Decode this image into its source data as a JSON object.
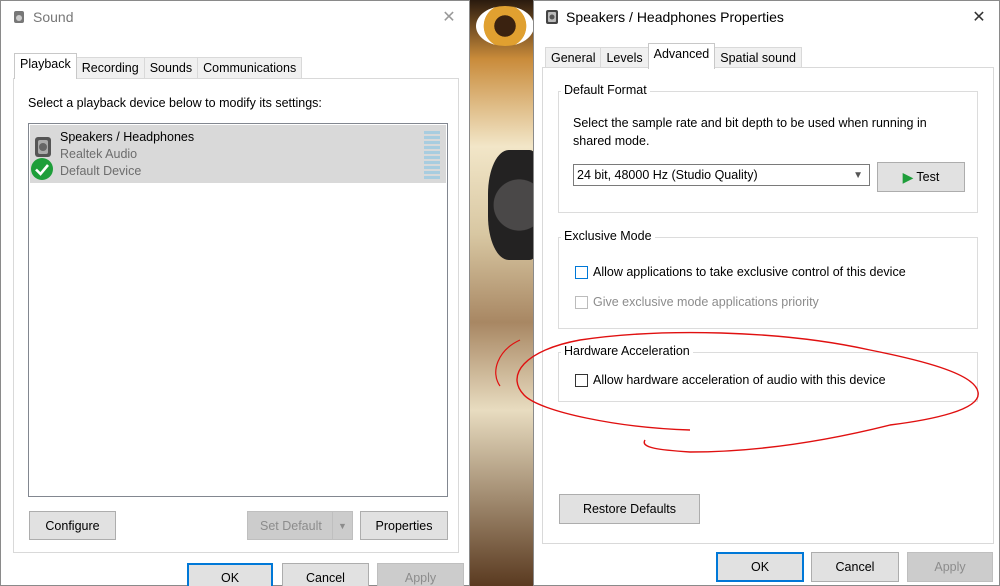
{
  "sound_window": {
    "title": "Sound",
    "tabs": [
      "Playback",
      "Recording",
      "Sounds",
      "Communications"
    ],
    "instruction": "Select a playback device below to modify its settings:",
    "device": {
      "name": "Speakers / Headphones",
      "driver": "Realtek Audio",
      "status": "Default Device"
    },
    "buttons": {
      "configure": "Configure",
      "set_default": "Set Default",
      "properties": "Properties",
      "ok": "OK",
      "cancel": "Cancel",
      "apply": "Apply"
    }
  },
  "props_window": {
    "title": "Speakers / Headphones Properties",
    "tabs": [
      "General",
      "Levels",
      "Advanced",
      "Spatial sound"
    ],
    "default_format": {
      "title": "Default Format",
      "description": "Select the sample rate and bit depth to be used when running in shared mode.",
      "selected": "24 bit, 48000 Hz (Studio Quality)",
      "test_label": "Test"
    },
    "exclusive_mode": {
      "title": "Exclusive Mode",
      "allow_label": "Allow applications to take exclusive control of this device",
      "priority_label": "Give exclusive mode applications priority"
    },
    "hardware_acceleration": {
      "title": "Hardware Acceleration",
      "allow_label": "Allow hardware acceleration of audio with this device"
    },
    "buttons": {
      "restore": "Restore Defaults",
      "ok": "OK",
      "cancel": "Cancel",
      "apply": "Apply"
    }
  },
  "colors": {
    "accent": "#0078d7",
    "check_green": "#1e9e3a",
    "annotation_red": "#e01010"
  }
}
